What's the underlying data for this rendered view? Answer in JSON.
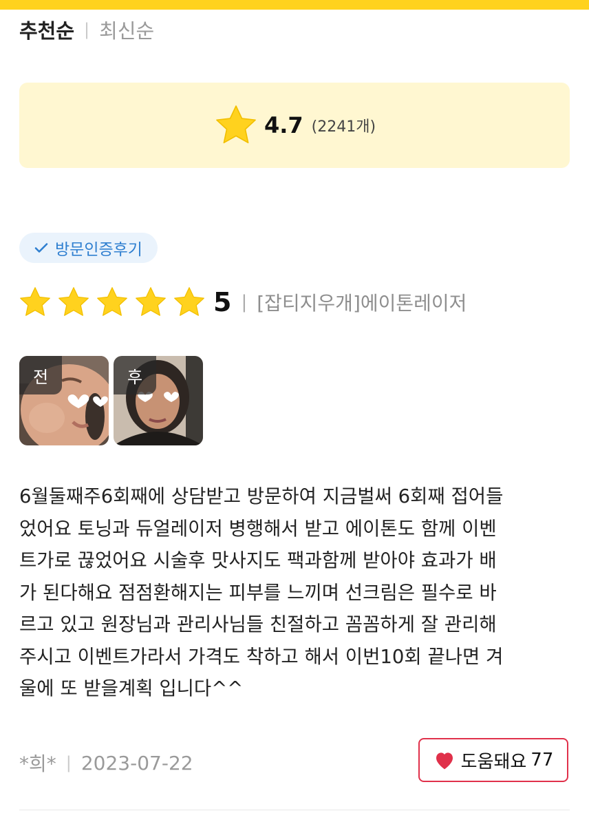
{
  "sort": {
    "active": "추천순",
    "inactive": "최신순"
  },
  "summary": {
    "average": "4.7",
    "count": "(2241개)"
  },
  "badge": {
    "label": "방문인증후기",
    "icon": "check-icon"
  },
  "review": {
    "rating": 5,
    "score": "5",
    "product": "[잡티지우개]에이톤레이저",
    "photos": [
      {
        "label": "전"
      },
      {
        "label": "후"
      }
    ],
    "text": "6월둘째주6회째에 상담받고 방문하여 지금벌써 6회째 접어들\n었어요 토닝과 듀얼레이저 병행해서 받고 에이톤도 함께 이벤\n트가로 끊었어요 시술후 맛사지도 팩과함께 받아야 효과가 배\n가 된다해요 점점환해지는 피부를 느끼며 선크림은 필수로 바\n르고 있고 원장님과 관리사님들 친절하고 꼼꼼하게 잘 관리해\n주시고 이벤트가라서 가격도 착하고 해서 이번10회 끝나면 겨\n울에 또 받을계획 입니다^^",
    "author": "*희*",
    "date": "2023-07-22",
    "helpful_label": "도움돼요",
    "helpful_count": "77"
  },
  "colors": {
    "accent": "#ffd21e",
    "star": "#ffd21e",
    "heart": "#e0304a",
    "badge_text": "#2f7fd0"
  }
}
